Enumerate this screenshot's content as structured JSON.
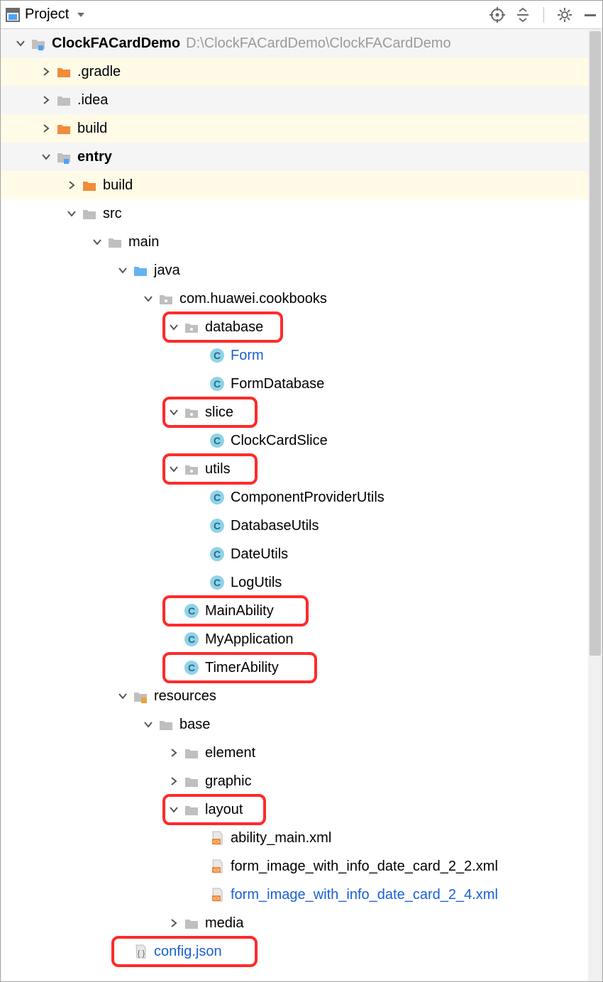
{
  "header": {
    "title": "Project"
  },
  "icons": {
    "project": "project-icon",
    "target": "target-icon",
    "collapse": "collapse-icon",
    "gear": "gear-icon",
    "minimize": "minimize-icon"
  },
  "tree": [
    {
      "depth": 0,
      "expand": "down",
      "icon": "module-blue",
      "label": "ClockFACardDemo",
      "bold": true,
      "path": "D:\\ClockFACardDemo\\ClockFACardDemo",
      "stripe": 1
    },
    {
      "depth": 1,
      "expand": "right",
      "icon": "folder-orange",
      "label": ".gradle",
      "stripe": 0
    },
    {
      "depth": 1,
      "expand": "right",
      "icon": "folder-grey",
      "label": ".idea",
      "stripe": 1
    },
    {
      "depth": 1,
      "expand": "right",
      "icon": "folder-orange",
      "label": "build",
      "stripe": 0
    },
    {
      "depth": 1,
      "expand": "down",
      "icon": "module-blue",
      "label": "entry",
      "bold": true,
      "stripe": 1
    },
    {
      "depth": 2,
      "expand": "right",
      "icon": "folder-orange",
      "label": "build",
      "stripe": 0
    },
    {
      "depth": 2,
      "expand": "down",
      "icon": "folder-grey",
      "label": "src",
      "stripe": 2
    },
    {
      "depth": 3,
      "expand": "down",
      "icon": "folder-grey",
      "label": "main",
      "stripe": 2
    },
    {
      "depth": 4,
      "expand": "down",
      "icon": "folder-blue",
      "label": "java",
      "stripe": 2
    },
    {
      "depth": 5,
      "expand": "down",
      "icon": "package-grey",
      "label": "com.huawei.cookbooks",
      "stripe": 2
    },
    {
      "depth": 6,
      "expand": "down",
      "icon": "package-grey",
      "label": "database",
      "stripe": 2,
      "highlight": true
    },
    {
      "depth": 7,
      "expand": "none",
      "icon": "class-c",
      "label": "Form",
      "blue": true,
      "stripe": 2
    },
    {
      "depth": 7,
      "expand": "none",
      "icon": "class-c",
      "label": "FormDatabase",
      "stripe": 2
    },
    {
      "depth": 6,
      "expand": "down",
      "icon": "package-grey",
      "label": "slice",
      "stripe": 2,
      "highlight": true
    },
    {
      "depth": 7,
      "expand": "none",
      "icon": "class-c",
      "label": "ClockCardSlice",
      "stripe": 2
    },
    {
      "depth": 6,
      "expand": "down",
      "icon": "package-grey",
      "label": "utils",
      "stripe": 2,
      "highlight": true
    },
    {
      "depth": 7,
      "expand": "none",
      "icon": "class-c",
      "label": "ComponentProviderUtils",
      "stripe": 2
    },
    {
      "depth": 7,
      "expand": "none",
      "icon": "class-c",
      "label": "DatabaseUtils",
      "stripe": 2
    },
    {
      "depth": 7,
      "expand": "none",
      "icon": "class-c",
      "label": "DateUtils",
      "stripe": 2
    },
    {
      "depth": 7,
      "expand": "none",
      "icon": "class-c",
      "label": "LogUtils",
      "stripe": 2
    },
    {
      "depth": 6,
      "expand": "none",
      "icon": "class-c",
      "label": "MainAbility",
      "stripe": 2,
      "highlight": true
    },
    {
      "depth": 6,
      "expand": "none",
      "icon": "class-c",
      "label": "MyApplication",
      "stripe": 2
    },
    {
      "depth": 6,
      "expand": "none",
      "icon": "class-c",
      "label": "TimerAbility",
      "stripe": 2,
      "highlight": true
    },
    {
      "depth": 4,
      "expand": "down",
      "icon": "folder-res",
      "label": "resources",
      "stripe": 2
    },
    {
      "depth": 5,
      "expand": "down",
      "icon": "folder-grey",
      "label": "base",
      "stripe": 2
    },
    {
      "depth": 6,
      "expand": "right",
      "icon": "folder-grey",
      "label": "element",
      "stripe": 2
    },
    {
      "depth": 6,
      "expand": "right",
      "icon": "folder-grey",
      "label": "graphic",
      "stripe": 2
    },
    {
      "depth": 6,
      "expand": "down",
      "icon": "folder-grey",
      "label": "layout",
      "stripe": 2,
      "highlight": true
    },
    {
      "depth": 7,
      "expand": "none",
      "icon": "xml-file",
      "label": "ability_main.xml",
      "stripe": 2
    },
    {
      "depth": 7,
      "expand": "none",
      "icon": "xml-file",
      "label": "form_image_with_info_date_card_2_2.xml",
      "stripe": 2
    },
    {
      "depth": 7,
      "expand": "none",
      "icon": "xml-file",
      "label": "form_image_with_info_date_card_2_4.xml",
      "blue": true,
      "stripe": 2
    },
    {
      "depth": 6,
      "expand": "right",
      "icon": "folder-grey",
      "label": "media",
      "stripe": 2
    },
    {
      "depth": 4,
      "expand": "none",
      "icon": "json-file",
      "label": "config.json",
      "blue": true,
      "stripe": 2,
      "highlight": true
    }
  ]
}
